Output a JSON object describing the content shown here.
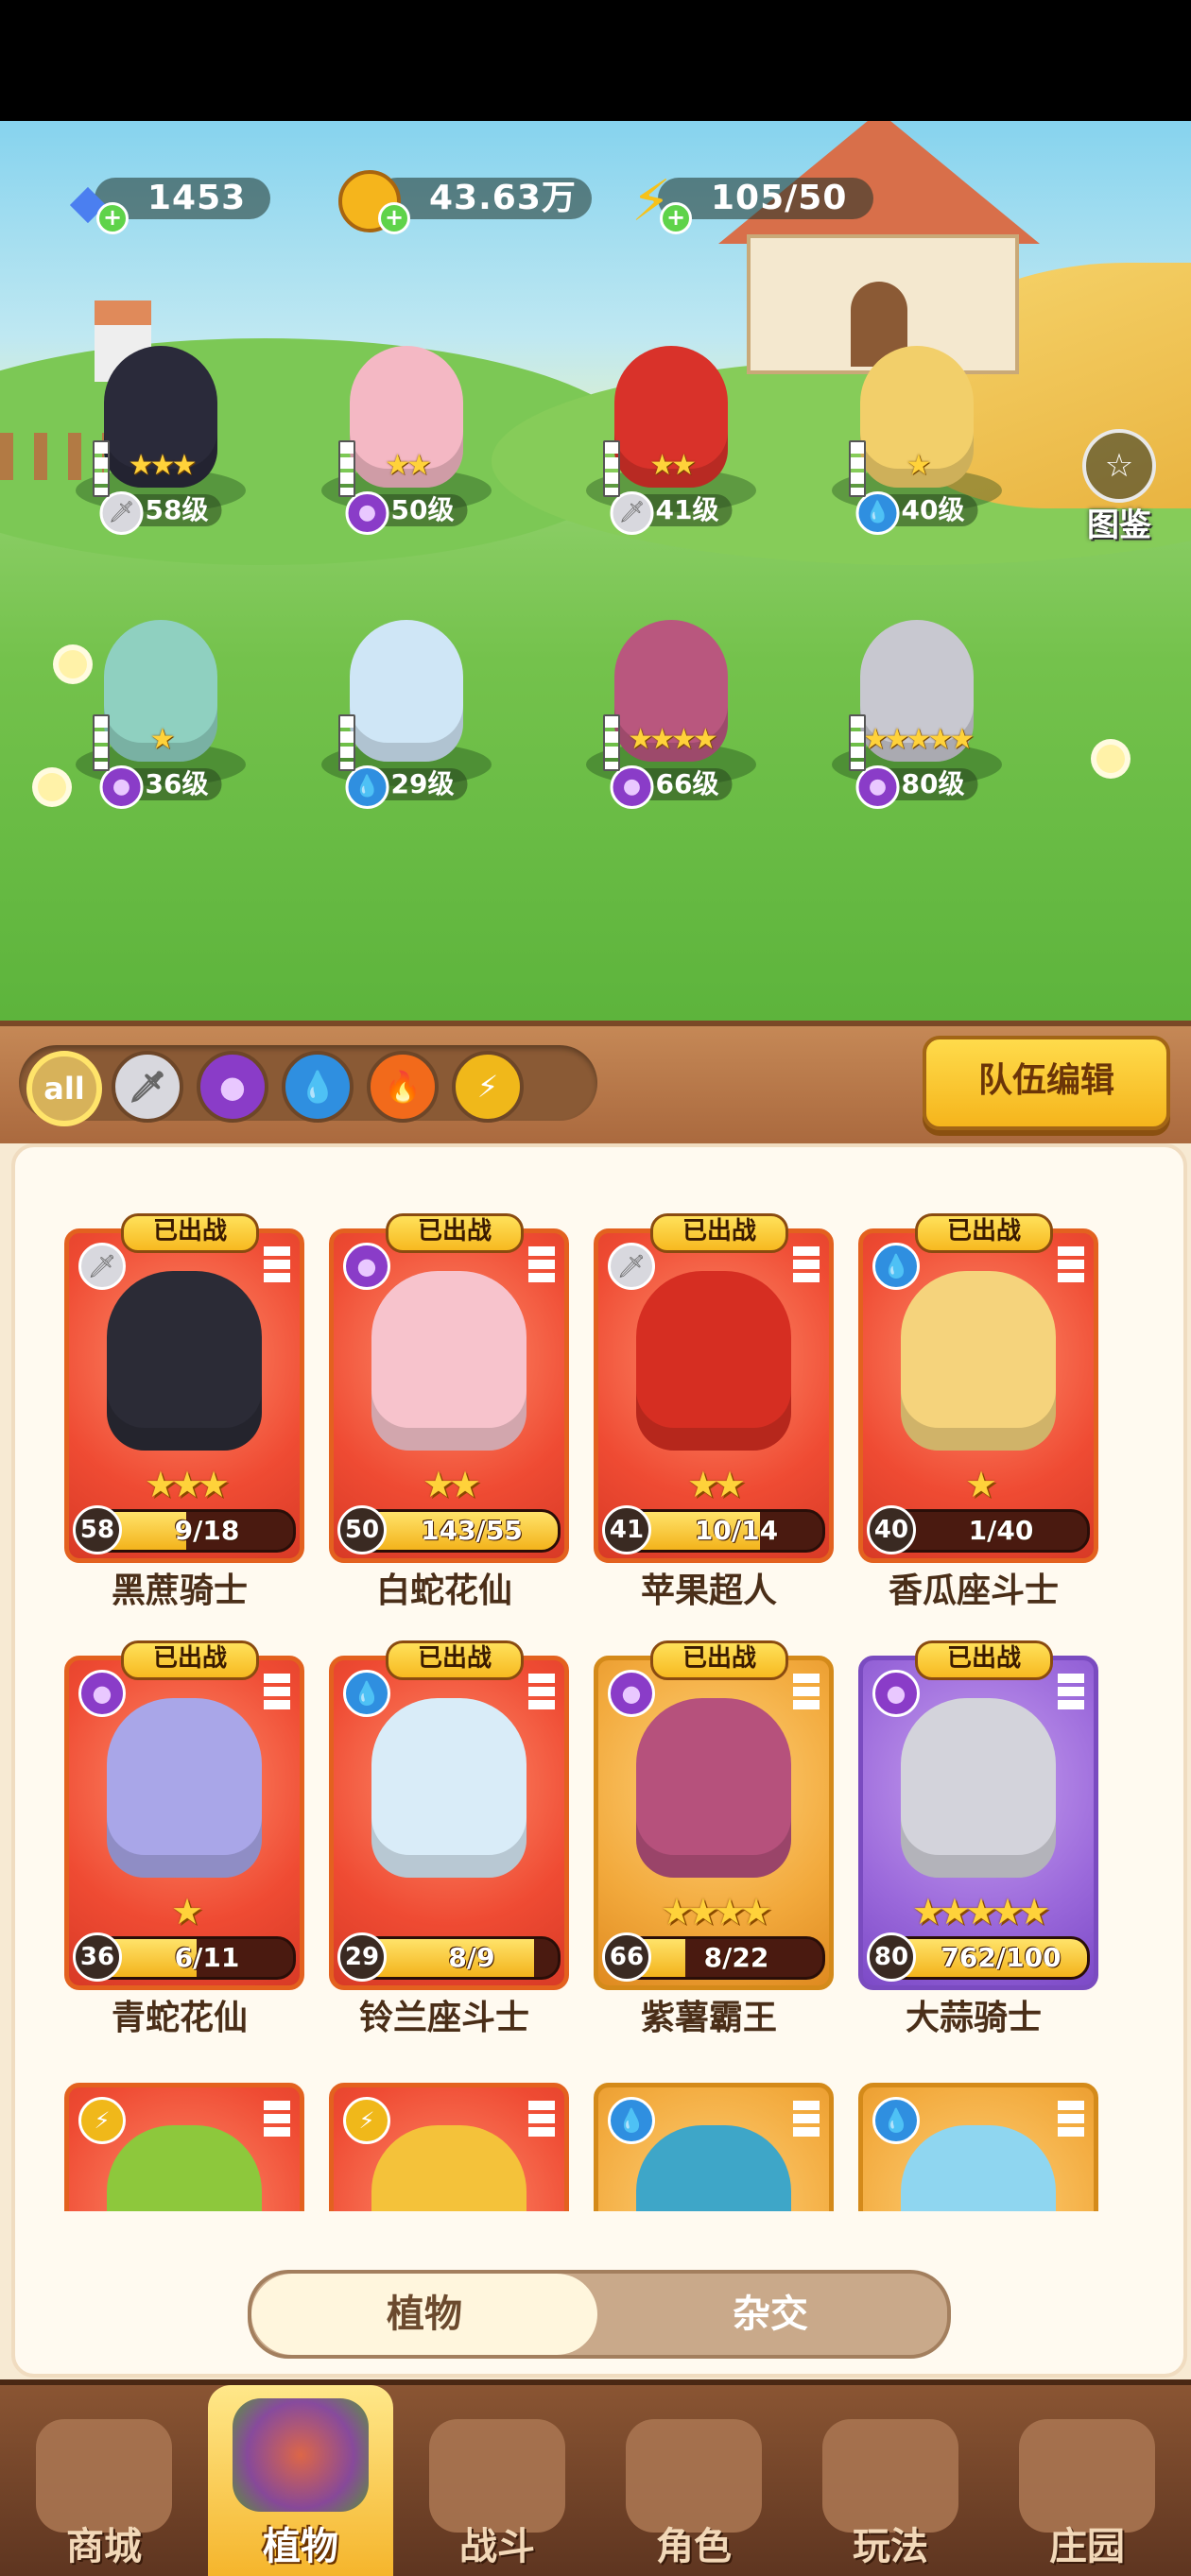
{
  "resources": {
    "gems": "1453",
    "gold": "43.63万",
    "energy": "105/50"
  },
  "codex_label": "图鉴",
  "field_units": [
    {
      "level": "58级",
      "stars": "★★★",
      "type_icon": "sword-icon",
      "body_color": "#2a2a3a"
    },
    {
      "level": "50级",
      "stars": "★★",
      "type_icon": "potion-icon",
      "body_color": "#f4b8c4"
    },
    {
      "level": "41级",
      "stars": "★★",
      "type_icon": "sword-icon",
      "body_color": "#d9322a"
    },
    {
      "level": "40级",
      "stars": "★",
      "type_icon": "water-drop-icon",
      "body_color": "#f2cf6a"
    },
    {
      "level": "36级",
      "stars": "★",
      "type_icon": "potion-icon",
      "body_color": "#8fd0c0"
    },
    {
      "level": "29级",
      "stars": "",
      "type_icon": "water-drop-icon",
      "body_color": "#cfe6f6"
    },
    {
      "level": "66级",
      "stars": "★★★★",
      "type_icon": "potion-icon",
      "body_color": "#b9577e"
    },
    {
      "level": "80级",
      "stars": "★★★★★",
      "type_icon": "potion-icon",
      "body_color": "#c8c8d0"
    }
  ],
  "filters": [
    "all",
    "sword-icon",
    "potion-icon",
    "water-drop-icon",
    "fire-icon",
    "lightning-icon"
  ],
  "team_edit_label": "队伍编辑",
  "deployed_label": "已出战",
  "cards": [
    {
      "name": "黑蔗骑士",
      "level": "58",
      "progress": "9/18",
      "fill": 0.5,
      "stars": "★★★",
      "frame": "red",
      "type_icon": "sword-icon",
      "deployed": true,
      "char_color": "#2b2b36"
    },
    {
      "name": "白蛇花仙",
      "level": "50",
      "progress": "143/55",
      "fill": 1.0,
      "stars": "★★",
      "frame": "red",
      "type_icon": "potion-icon",
      "deployed": true,
      "char_color": "#f7c3cc"
    },
    {
      "name": "苹果超人",
      "level": "41",
      "progress": "10/14",
      "fill": 0.71,
      "stars": "★★",
      "frame": "red",
      "type_icon": "sword-icon",
      "deployed": true,
      "char_color": "#d62e22"
    },
    {
      "name": "香瓜座斗士",
      "level": "40",
      "progress": "1/40",
      "fill": 0.03,
      "stars": "★",
      "frame": "red",
      "type_icon": "water-drop-icon",
      "deployed": true,
      "char_color": "#f5d37c"
    },
    {
      "name": "青蛇花仙",
      "level": "36",
      "progress": "6/11",
      "fill": 0.55,
      "stars": "★",
      "frame": "red",
      "type_icon": "potion-icon",
      "deployed": true,
      "char_color": "#a9a6e8"
    },
    {
      "name": "铃兰座斗士",
      "level": "29",
      "progress": "8/9",
      "fill": 0.89,
      "stars": "",
      "frame": "red",
      "type_icon": "water-drop-icon",
      "deployed": true,
      "char_color": "#d9ecf8"
    },
    {
      "name": "紫薯霸王",
      "level": "66",
      "progress": "8/22",
      "fill": 0.36,
      "stars": "★★★★",
      "frame": "gold",
      "type_icon": "potion-icon",
      "deployed": true,
      "char_color": "#b6517c"
    },
    {
      "name": "大蒜骑士",
      "level": "80",
      "progress": "762/100",
      "fill": 1.0,
      "stars": "★★★★★",
      "frame": "purple",
      "type_icon": "potion-icon",
      "deployed": true,
      "char_color": "#d3d3db"
    },
    {
      "name": "",
      "level": "",
      "progress": "",
      "fill": 0,
      "stars": "",
      "frame": "red",
      "type_icon": "lightning-icon",
      "deployed": false,
      "char_color": "#8dc83c"
    },
    {
      "name": "",
      "level": "",
      "progress": "",
      "fill": 0,
      "stars": "",
      "frame": "red",
      "type_icon": "lightning-icon",
      "deployed": false,
      "char_color": "#f4c23a"
    },
    {
      "name": "",
      "level": "",
      "progress": "",
      "fill": 0,
      "stars": "",
      "frame": "gold",
      "type_icon": "water-drop-icon",
      "deployed": false,
      "char_color": "#3ea6c8"
    },
    {
      "name": "",
      "level": "",
      "progress": "",
      "fill": 0,
      "stars": "",
      "frame": "gold",
      "type_icon": "water-drop-icon",
      "deployed": false,
      "char_color": "#8fd6f0"
    }
  ],
  "tabs": {
    "plants": "植物",
    "hybrid": "杂交"
  },
  "nav": [
    {
      "label": "商城",
      "active": false
    },
    {
      "label": "植物",
      "active": true
    },
    {
      "label": "战斗",
      "active": false
    },
    {
      "label": "角色",
      "active": false
    },
    {
      "label": "玩法",
      "active": false
    },
    {
      "label": "庄园",
      "active": false
    }
  ],
  "colors": {
    "sword": "#b9b9c2",
    "potion": "#8a3cc8",
    "water": "#2f8fe0",
    "fire": "#f26a1b",
    "lightning": "#f0b81a"
  }
}
